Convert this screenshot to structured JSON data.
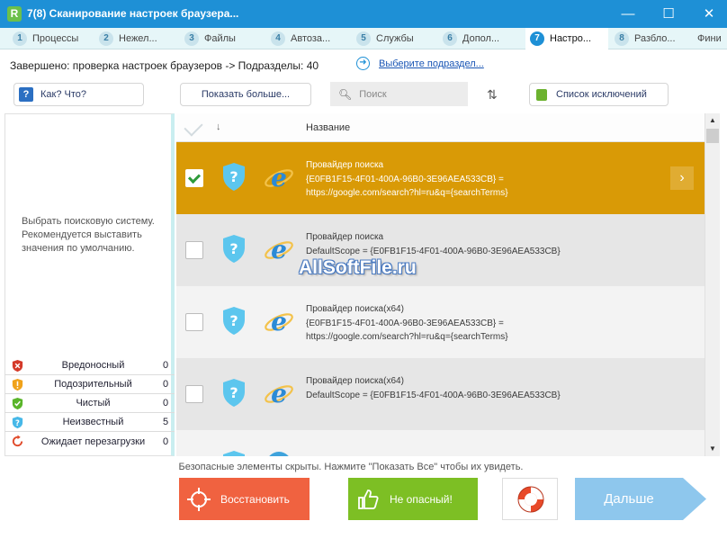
{
  "window": {
    "title": "7(8) Сканирование настроек браузера...",
    "app_icon": "R",
    "minimize": "—",
    "maximize": "☐",
    "close": "✕"
  },
  "tabs": [
    {
      "num": "1",
      "label": "Процессы"
    },
    {
      "num": "2",
      "label": "Нежел..."
    },
    {
      "num": "3",
      "label": "Файлы"
    },
    {
      "num": "4",
      "label": "Автоза..."
    },
    {
      "num": "5",
      "label": "Службы"
    },
    {
      "num": "6",
      "label": "Допол..."
    },
    {
      "num": "7",
      "label": "Настро...",
      "active": true
    },
    {
      "num": "8",
      "label": "Разбло..."
    },
    {
      "num": "",
      "label": "Фини"
    }
  ],
  "status": {
    "text": "Завершено: проверка настроек браузеров -> Подразделы: 40",
    "select_link": "Выберите подраздел..."
  },
  "toolbar": {
    "howto_icon": "?",
    "howto_label": "Как? Что?",
    "show_more_label": "Показать больше...",
    "search_placeholder": "Поиск",
    "exclusions_label": "Список исключений"
  },
  "left_panel": {
    "description": "Выбрать поисковую систему. Рекомендуется выставить значения по умолчанию."
  },
  "legend": [
    {
      "label": "Вредоносный",
      "count": "0",
      "color": "#d43a2a",
      "icon": "malicious-shield-icon"
    },
    {
      "label": "Подозрительный",
      "count": "0",
      "color": "#f0a21a",
      "icon": "suspicious-shield-icon"
    },
    {
      "label": "Чистый",
      "count": "0",
      "color": "#5ab52a",
      "icon": "clean-shield-icon"
    },
    {
      "label": "Неизвестный",
      "count": "5",
      "color": "#47b8e8",
      "icon": "unknown-shield-icon"
    },
    {
      "label": "Ожидает перезагрузки",
      "count": "0",
      "color": "#e04a2a",
      "icon": "reboot-pending-icon"
    }
  ],
  "table": {
    "header": {
      "name_label": "Название",
      "sort_arrow": "↓"
    },
    "rows": [
      {
        "line1": "Провайдер поиска",
        "line2": "{E0FB1F15-4F01-400A-96B0-3E96AEA533CB} =",
        "line3": "https://google.com/search?hl=ru&q={searchTerms}",
        "checked": true,
        "selected": true
      },
      {
        "line1": "Провайдер поиска",
        "line2": "DefaultScope = {E0FB1F15-4F01-400A-96B0-3E96AEA533CB}",
        "line3": "",
        "checked": false,
        "selected": false
      },
      {
        "line1": "Провайдер поиска(x64)",
        "line2": "{E0FB1F15-4F01-400A-96B0-3E96AEA533CB} =",
        "line3": "https://google.com/search?hl=ru&q={searchTerms}",
        "checked": false,
        "selected": false
      },
      {
        "line1": "Провайдер поиска(x64)",
        "line2": "DefaultScope = {E0FB1F15-4F01-400A-96B0-3E96AEA533CB}",
        "line3": "",
        "checked": false,
        "selected": false
      },
      {
        "line1": "",
        "line2": "",
        "line3": "",
        "checked": false,
        "selected": false
      }
    ],
    "selected_color": "#d99a06"
  },
  "watermark": "AllSoftFile.ru",
  "bottom": {
    "hidden_note": "Безопасные элементы скрыты. Нажмите \"Показать Все\" чтобы их увидеть.",
    "restore_label": "Восстановить",
    "safe_label": "Не опасный!",
    "next_label": "Дальше"
  }
}
